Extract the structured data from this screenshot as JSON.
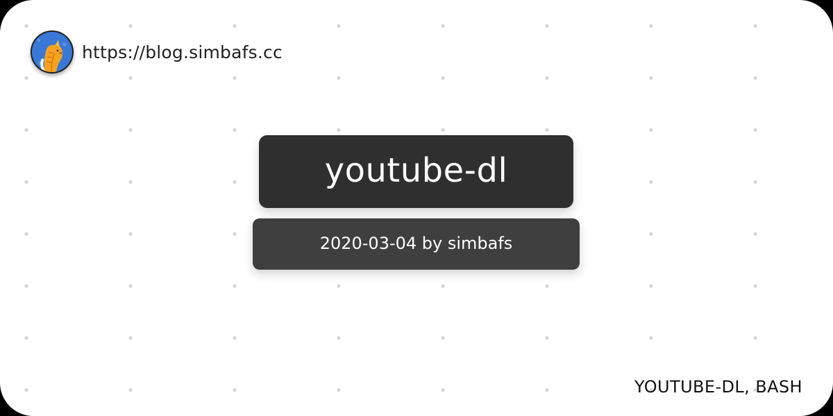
{
  "site": {
    "url": "https://blog.simbafs.cc",
    "avatar_icon": "cat-avatar-icon"
  },
  "post": {
    "title": "youtube-dl",
    "meta": "2020-03-04 by simbafs",
    "tags": "YOUTUBE-DL, BASH"
  },
  "colors": {
    "page_background": "#ffffff",
    "dot_color": "#d4d4d4",
    "title_box": "#2f2f2f",
    "meta_box": "#3f3f3f",
    "text_dark": "#1f1f1f",
    "text_light": "#ffffff",
    "avatar_background": "#3a78d8",
    "avatar_cat": "#f4a321"
  }
}
